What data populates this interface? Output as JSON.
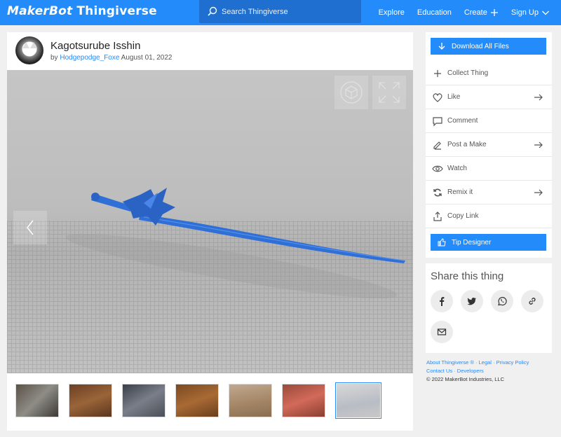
{
  "nav": {
    "brand_part1": "MakerBot",
    "brand_part2": "Thingiverse",
    "search_placeholder": "Search Thingiverse",
    "links": {
      "explore": "Explore",
      "education": "Education",
      "create": "Create",
      "signup": "Sign Up"
    }
  },
  "thing": {
    "title": "Kagotsurube Isshin",
    "by": "by",
    "author": "Hodgepodge_Foxe",
    "date": "August 01, 2022"
  },
  "actions": {
    "download": "Download All Files",
    "collect": "Collect Thing",
    "like": "Like",
    "comment": "Comment",
    "post_make": "Post a Make",
    "watch": "Watch",
    "remix": "Remix it",
    "copy_link": "Copy Link",
    "tip": "Tip Designer"
  },
  "share": {
    "title": "Share this thing"
  },
  "footer": {
    "about": "About Thingiverse ®",
    "legal": "Legal",
    "privacy": "Privacy Policy",
    "contact": "Contact Us",
    "developers": "Developers",
    "copyright": "©  2022  MakerBot Industries, LLC"
  },
  "colors": {
    "brand_blue": "#248bfb",
    "model_blue": "#2f6fd6"
  }
}
